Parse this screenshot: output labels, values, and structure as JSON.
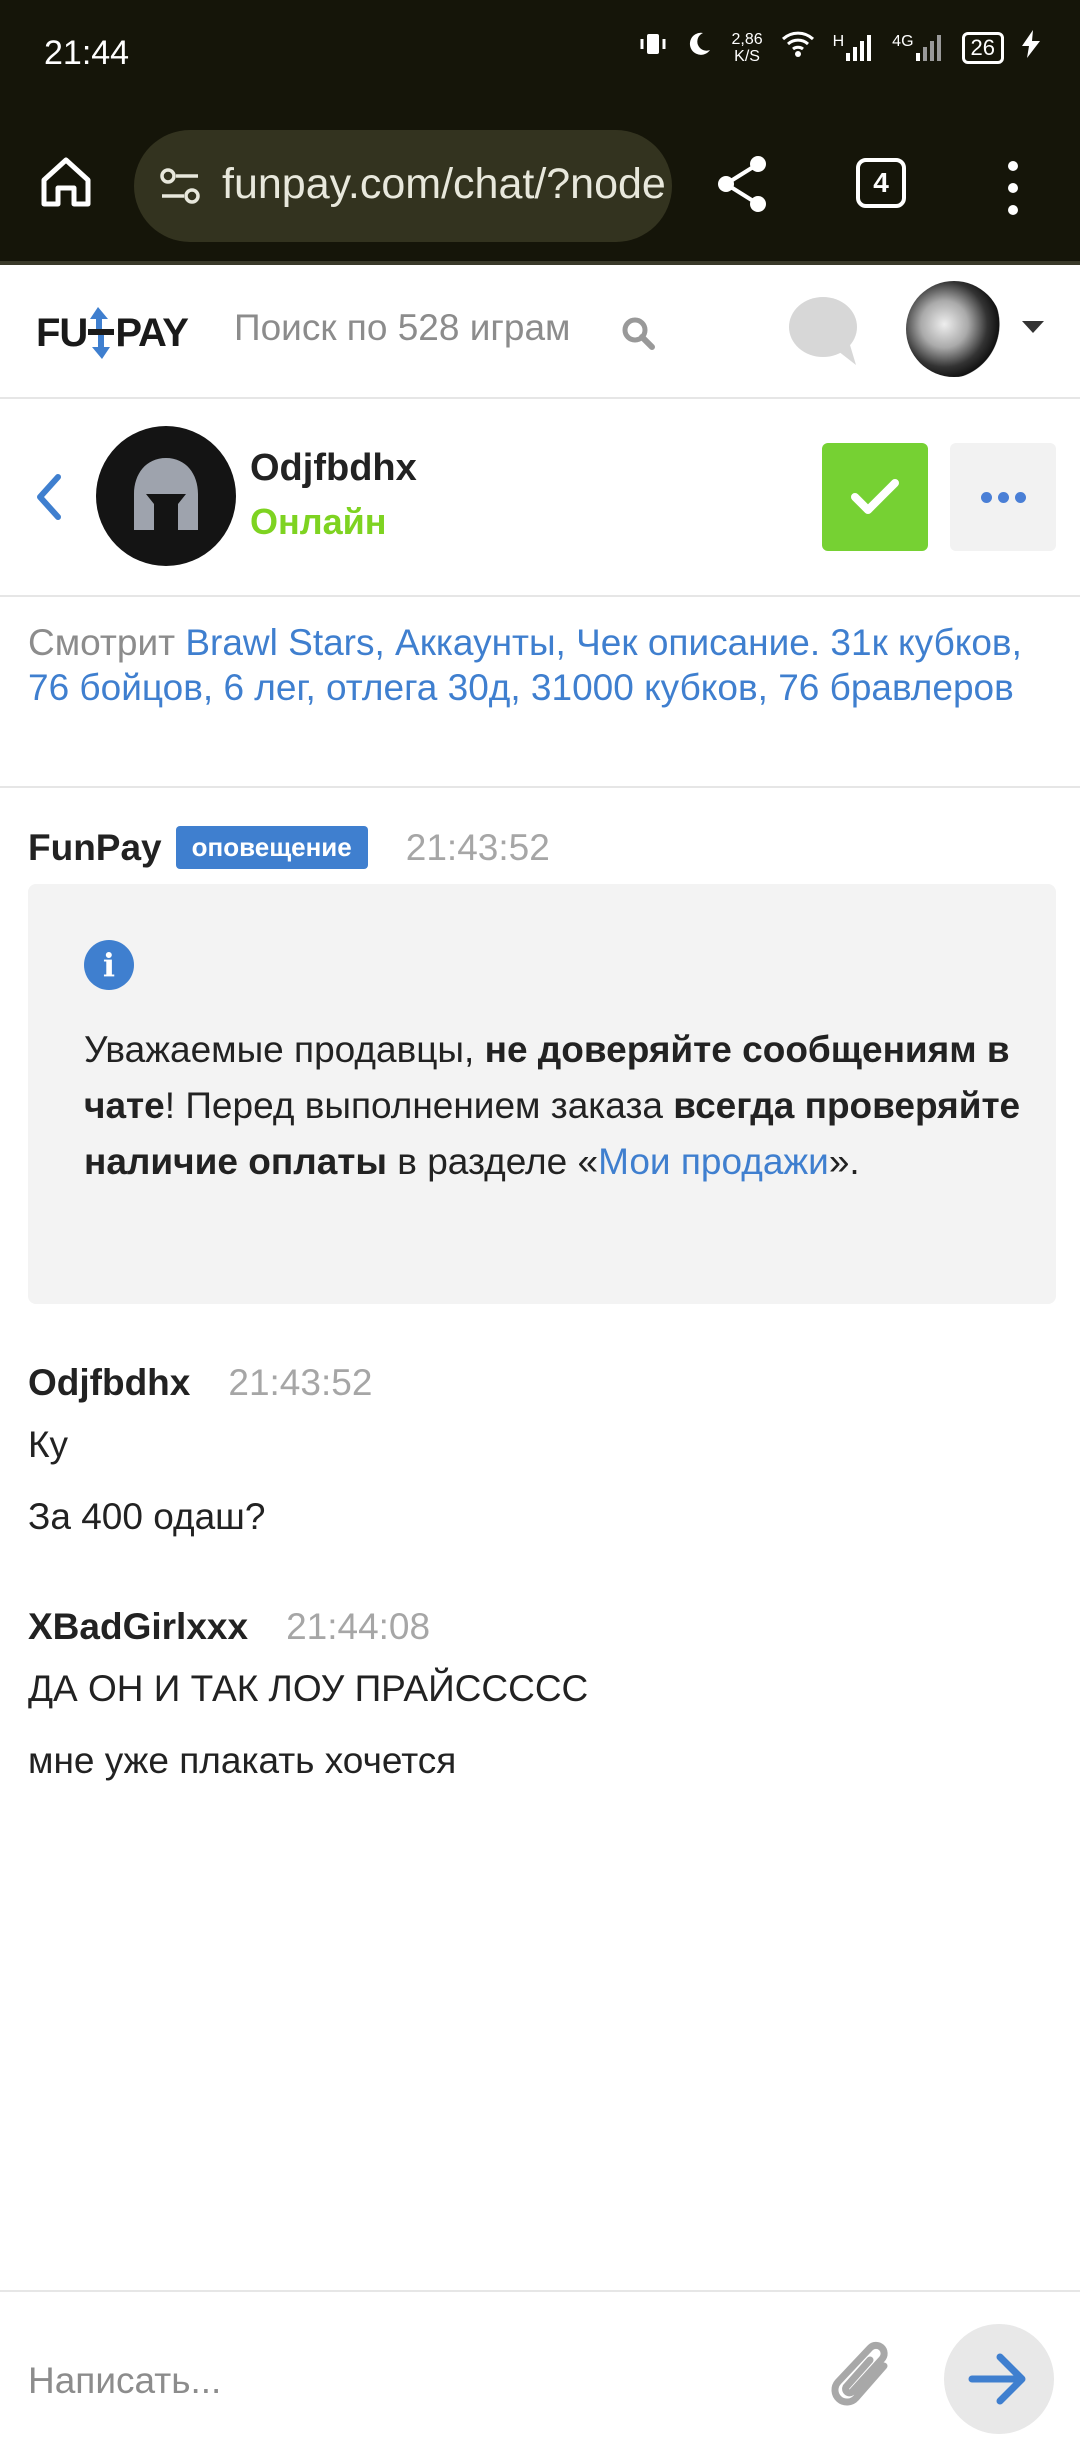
{
  "status_bar": {
    "time": "21:44",
    "speed_value": "2,86",
    "speed_unit": "K/S",
    "network_h": "H",
    "network_4g": "4G",
    "battery": "26"
  },
  "browser": {
    "url": "funpay.com/chat/?node",
    "tab_count": "4"
  },
  "header": {
    "logo_left": "FU",
    "logo_right": "PAY",
    "search_placeholder": "Поиск по 528 играм"
  },
  "chat": {
    "contact_name": "Odjfbdhx",
    "contact_status": "Онлайн",
    "watching_prefix": "Смотрит ",
    "watching_link": "Brawl Stars, Аккаунты, Чек описание. 31к кубков, 76 бойцов, 6 лег, отлега 30д, 31000 кубков, 76 бравлеров"
  },
  "messages": [
    {
      "author": "FunPay",
      "badge": "оповещение",
      "time": "21:43:52",
      "alert": {
        "icon_text": "i",
        "p1": "Уважаемые продавцы, ",
        "b1": "не доверяйте сообщениям в чате",
        "p2": "! Перед выполнением заказа ",
        "b2": "всегда проверяйте наличие оплаты",
        "p3": " в разделе «",
        "link": "Мои продажи",
        "p4": "»."
      }
    },
    {
      "author": "Odjfbdhx",
      "time": "21:43:52",
      "lines": [
        "Ку",
        "За 400 одаш?"
      ]
    },
    {
      "author": "XBadGirlxxx",
      "time": "21:44:08",
      "lines": [
        "ДА ОН И ТАК ЛОУ ПРАЙССССС",
        "мне уже плакать хочется"
      ]
    }
  ],
  "composer": {
    "placeholder": "Написать..."
  },
  "colors": {
    "accent_blue": "#3f7fcf",
    "online_green": "#7ed321",
    "confirm_green": "#76d133",
    "browser_dark": "#151509"
  }
}
